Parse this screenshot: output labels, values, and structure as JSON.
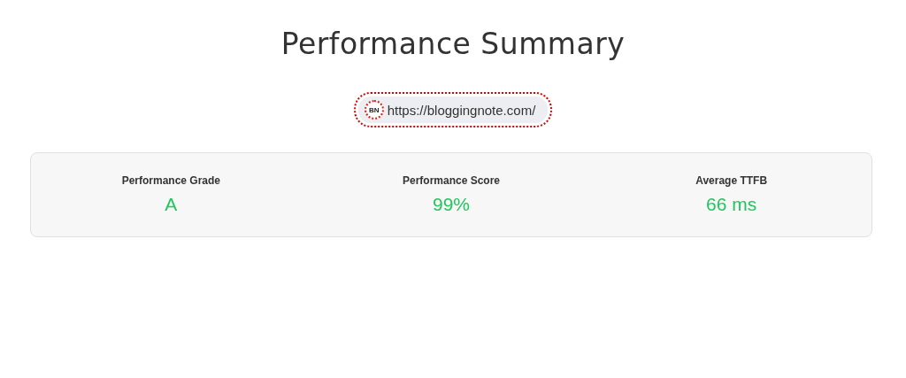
{
  "title": "Performance Summary",
  "site": {
    "logo": "BN",
    "url": "https://bloggingnote.com/",
    "focused": true
  },
  "metrics": [
    {
      "label": "Performance Grade",
      "value": "A"
    },
    {
      "label": "Performance Score",
      "value": "99%"
    },
    {
      "label": "Average TTFB",
      "value": "66 ms"
    }
  ]
}
